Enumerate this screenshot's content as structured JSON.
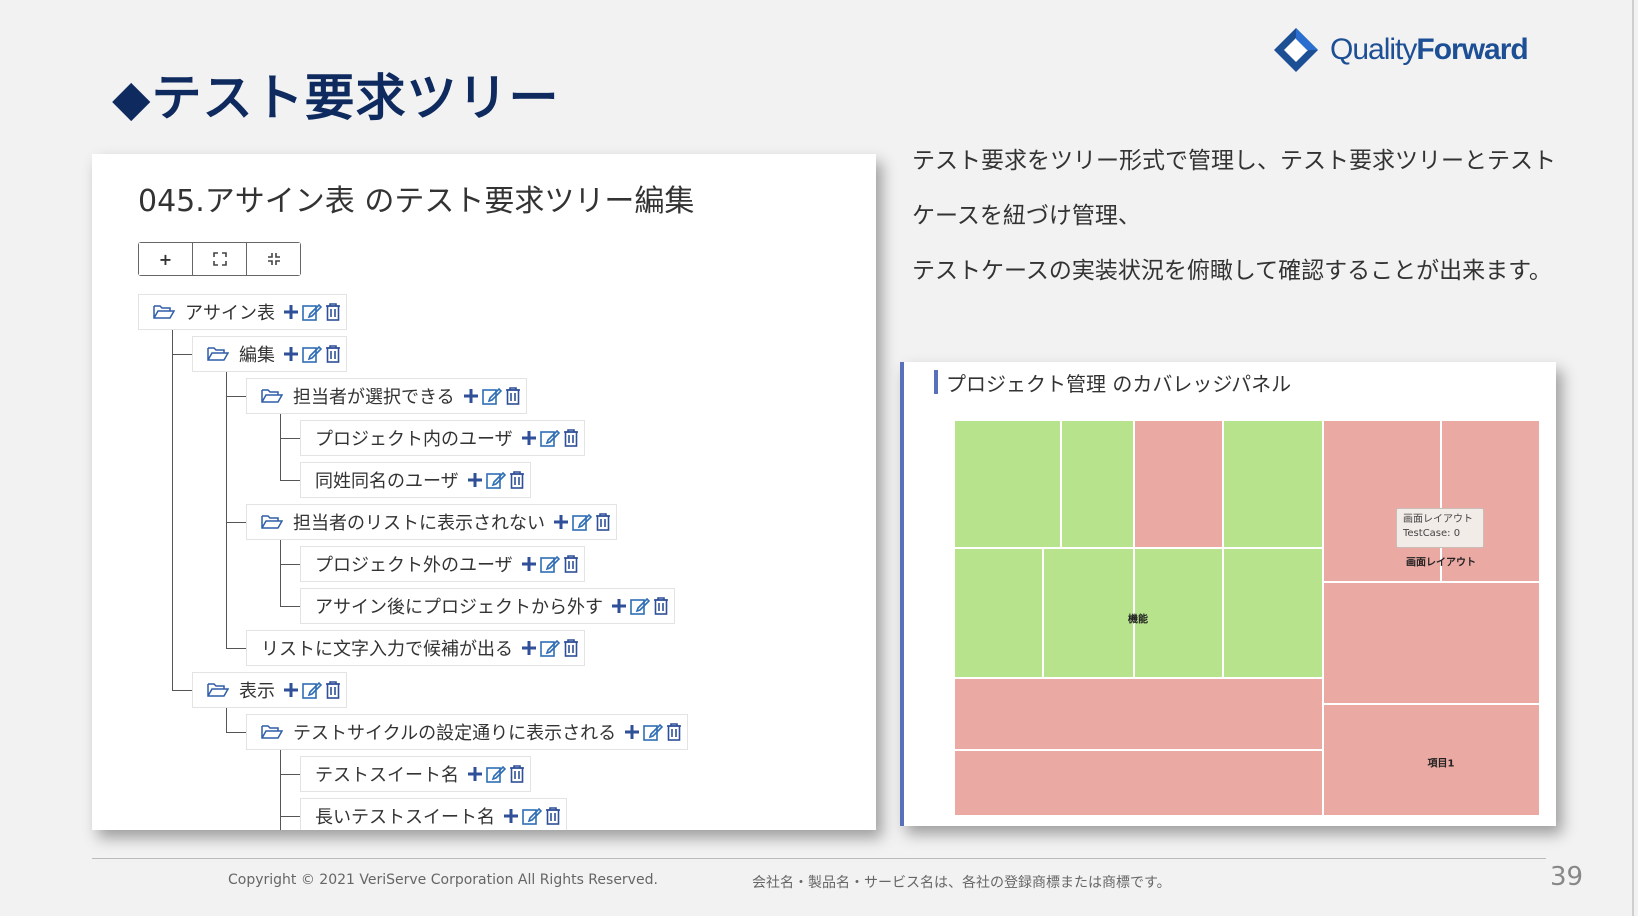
{
  "slide": {
    "title": "◆テスト要求ツリー",
    "logo": {
      "name_light": "Quality",
      "name_bold": "Forward"
    },
    "description": [
      "テスト要求をツリー形式で管理し、テスト要求ツリーとテスト",
      "ケースを紐づけ管理、",
      "テストケースの実装状況を俯瞰して確認することが出来ます。"
    ],
    "page_number": "39"
  },
  "tree_panel": {
    "title": "045.アサイン表 のテスト要求ツリー編集",
    "toolbar": {
      "add": "+",
      "expand_icon": "expand-icon",
      "collapse_icon": "collapse-icon"
    },
    "nodes": [
      {
        "label": "アサイン表",
        "folder": true,
        "level": 0
      },
      {
        "label": "編集",
        "folder": true,
        "level": 1
      },
      {
        "label": "担当者が選択できる",
        "folder": true,
        "level": 2
      },
      {
        "label": "プロジェクト内のユーザ",
        "folder": false,
        "level": 3
      },
      {
        "label": "同姓同名のユーザ",
        "folder": false,
        "level": 3
      },
      {
        "label": "担当者のリストに表示されない",
        "folder": true,
        "level": 2
      },
      {
        "label": "プロジェクト外のユーザ",
        "folder": false,
        "level": 3
      },
      {
        "label": "アサイン後にプロジェクトから外す",
        "folder": false,
        "level": 3
      },
      {
        "label": "リストに文字入力で候補が出る",
        "folder": false,
        "level": 2
      },
      {
        "label": "表示",
        "folder": true,
        "level": 1
      },
      {
        "label": "テストサイクルの設定通りに表示される",
        "folder": true,
        "level": 2
      },
      {
        "label": "テストスイート名",
        "folder": false,
        "level": 3
      },
      {
        "label": "長いテストスイート名",
        "folder": false,
        "level": 3
      }
    ],
    "action_colors": {
      "add": "#2f4f98",
      "edit": "#2f6db5",
      "delete": "#2f4f98"
    }
  },
  "coverage_panel": {
    "title": "プロジェクト管理 のカバレッジパネル",
    "labels": {
      "function": "機能",
      "layout": "画面レイアウト",
      "item": "項目1"
    },
    "tooltip": {
      "title": "画面レイアウト",
      "testcase": "TestCase: 0"
    },
    "colors": {
      "covered": "#b7e38c",
      "uncovered": "#eba9a3"
    }
  },
  "footer": {
    "copyright": "Copyright © 2021 VeriServe Corporation All Rights Reserved.",
    "trademark": "会社名・製品名・サービス名は、各社の登録商標または商標です。"
  }
}
